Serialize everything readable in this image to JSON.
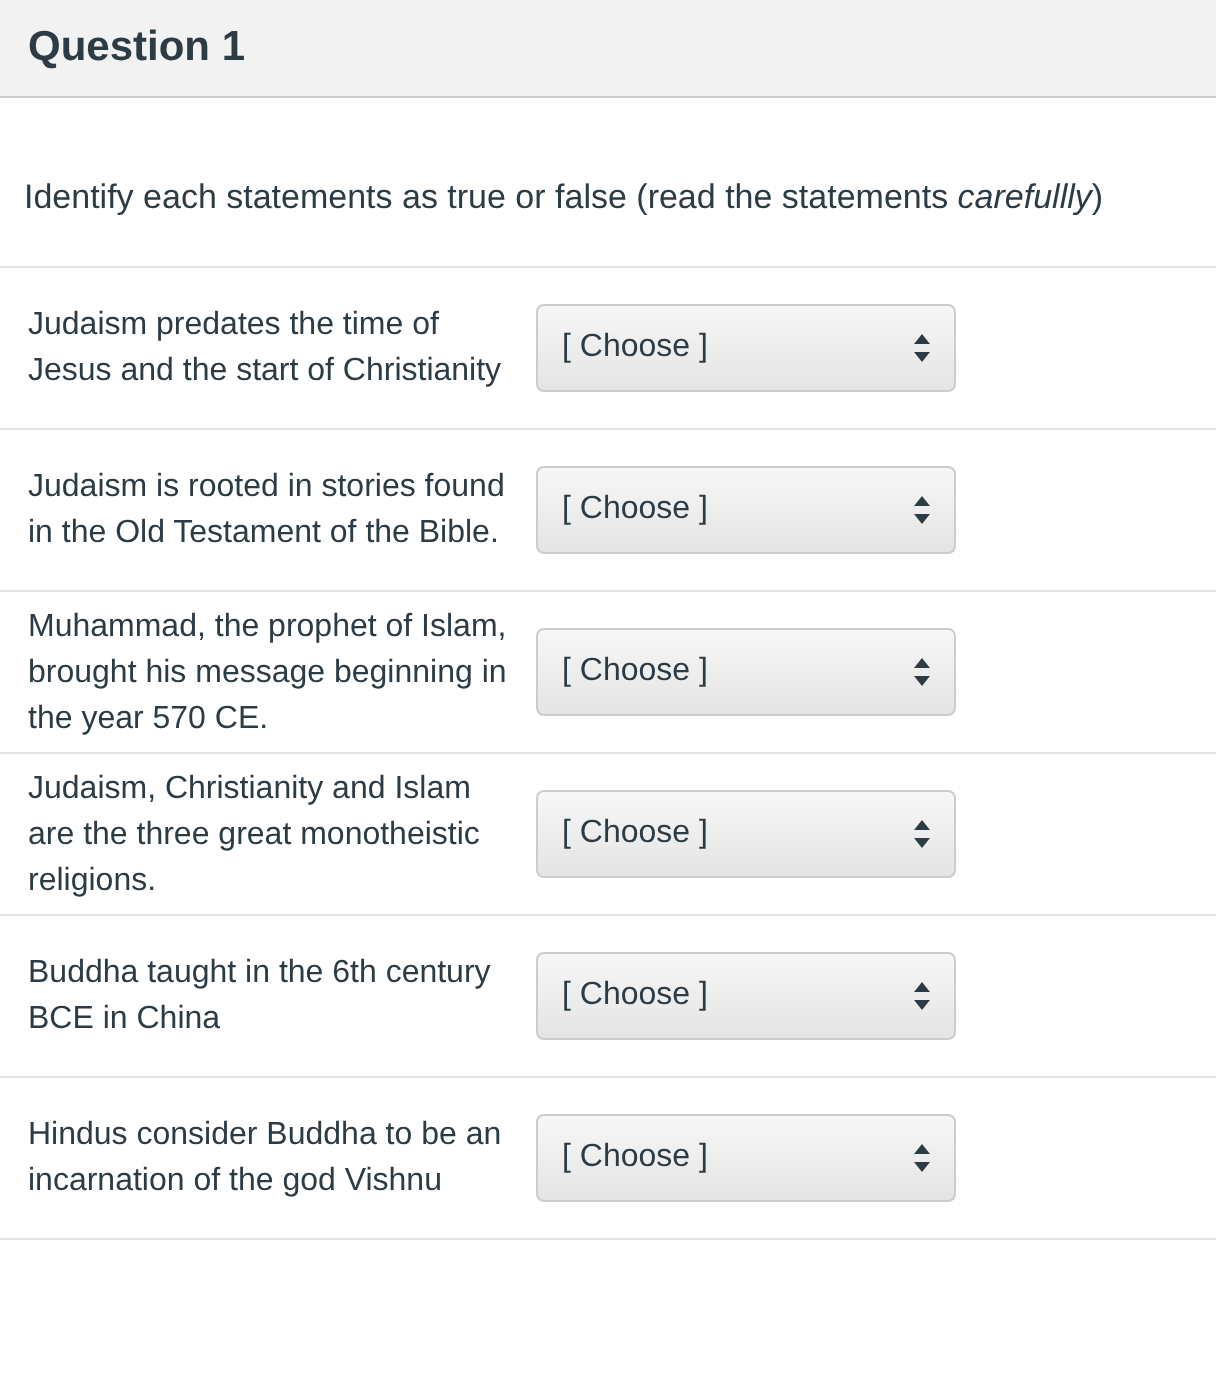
{
  "question": {
    "title": "Question 1",
    "instruction": "Identify each statements as true or false (read the statements *carefullly*)"
  },
  "items": [
    {
      "statement": "Judaism predates the time of Jesus and the start of Christianity",
      "answer": "[ Choose ]"
    },
    {
      "statement": "Judaism is rooted in stories found in the Old Testament of the Bible.",
      "answer": "[ Choose ]"
    },
    {
      "statement": "Muhammad, the prophet of Islam, brought his message beginning in the year 570 CE.",
      "answer": "[ Choose ]"
    },
    {
      "statement": "Judaism, Christianity and Islam are the three great monotheistic religions.",
      "answer": "[ Choose ]"
    },
    {
      "statement": "Buddha taught in the 6th century BCE in China",
      "answer": "[ Choose ]"
    },
    {
      "statement": "Hindus consider Buddha to be an incarnation of the god Vishnu",
      "answer": "[ Choose ]"
    }
  ]
}
